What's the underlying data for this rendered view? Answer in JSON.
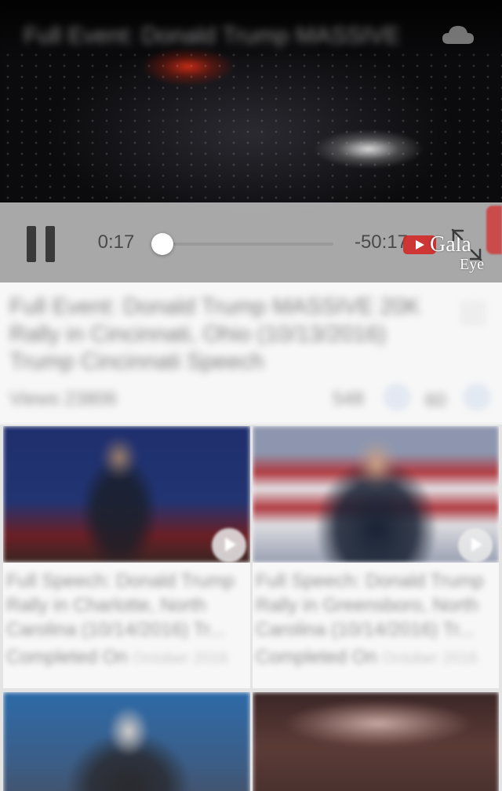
{
  "player": {
    "title": "Full Event: Donald Trump MASSIVE",
    "elapsed": "0:17",
    "remaining": "-50:17",
    "progress_fraction": 0.005,
    "watermark_line1": "Gala",
    "watermark_line2": "Eye"
  },
  "video": {
    "title": "Full Event: Donald Trump MASSIVE 20K Rally in Cincinnati, Ohio (10/13/2016) Trump Cincinnati Speech",
    "views": "Views 23806",
    "likes": "548",
    "dislikes": "60"
  },
  "related": [
    {
      "title": "Full Speech: Donald Trump Rally in Charlotte, North Carolina (10/14/2016) Tr...",
      "meta": "Completed On",
      "meta_sub": "October 2016"
    },
    {
      "title": "Full Speech: Donald Trump Rally in Greensboro, North Carolina (10/14/2016) Tr...",
      "meta": "Completed On",
      "meta_sub": "October 2016"
    },
    {
      "title": "",
      "meta": "",
      "meta_sub": ""
    },
    {
      "title": "",
      "meta": "",
      "meta_sub": ""
    }
  ],
  "icons": {
    "pause": "pause-icon",
    "fullscreen": "fullscreen-icon",
    "cloud": "cloud-icon",
    "like": "thumbs-up-icon",
    "dislike": "thumbs-down-icon",
    "share": "share-icon",
    "play": "play-icon"
  }
}
